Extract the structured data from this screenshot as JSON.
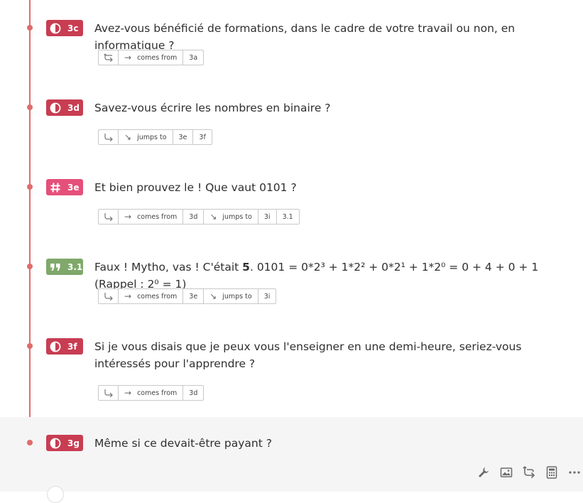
{
  "colors": {
    "timeline": "#e06c6c",
    "badge_choice": "#c83d52",
    "badge_number": "#e4507a",
    "badge_statement": "#7fa86a"
  },
  "questions": [
    {
      "id": "3c",
      "type_icon": "half-circle-icon",
      "color": "red",
      "text": "Avez-vous bénéficié de formations, dans le cadre de votre travail ou non, en informatique ?",
      "logic": {
        "comes_from_label": "comes from",
        "comes_from": [
          "3a"
        ],
        "jumps_to_label": "",
        "jumps_to": []
      }
    },
    {
      "id": "3d",
      "type_icon": "half-circle-icon",
      "color": "red",
      "text": "Savez-vous écrire les nombres en binaire ?",
      "logic": {
        "comes_from_label": "",
        "comes_from": [],
        "jumps_to_label": "jumps to",
        "jumps_to": [
          "3e",
          "3f"
        ]
      }
    },
    {
      "id": "3e",
      "type_icon": "hash-icon",
      "color": "pink",
      "text": "Et bien prouvez le ! Que vaut 0101 ?",
      "logic": {
        "comes_from_label": "comes from",
        "comes_from": [
          "3d"
        ],
        "jumps_to_label": "jumps to",
        "jumps_to": [
          "3i",
          "3.1"
        ]
      }
    },
    {
      "id": "3.1",
      "type_icon": "quote-icon",
      "color": "green",
      "text_before": "Faux ! Mytho, vas ! C'était ",
      "text_bold": "5",
      "text_after": ". 0101 = 0*2³ + 1*2² + 0*2¹ + 1*2⁰ = 0 + 4 + 0 + 1 (Rappel : 2⁰ = 1)",
      "logic": {
        "comes_from_label": "comes from",
        "comes_from": [
          "3e"
        ],
        "jumps_to_label": "jumps to",
        "jumps_to": [
          "3i"
        ]
      }
    },
    {
      "id": "3f",
      "type_icon": "half-circle-icon",
      "color": "red",
      "text": "Si je vous disais que je peux vous l'enseigner en une demi-heure, seriez-vous intéressés pour l'apprendre ?",
      "logic": {
        "comes_from_label": "comes from",
        "comes_from": [
          "3d"
        ],
        "jumps_to_label": "",
        "jumps_to": []
      }
    },
    {
      "id": "3g",
      "type_icon": "half-circle-icon",
      "color": "red",
      "text": "Même si ce devait-être payant ?"
    }
  ],
  "toolbar": {
    "items": [
      "wrench-icon",
      "image-icon",
      "logic-icon",
      "calculator-icon",
      "more-icon"
    ]
  }
}
